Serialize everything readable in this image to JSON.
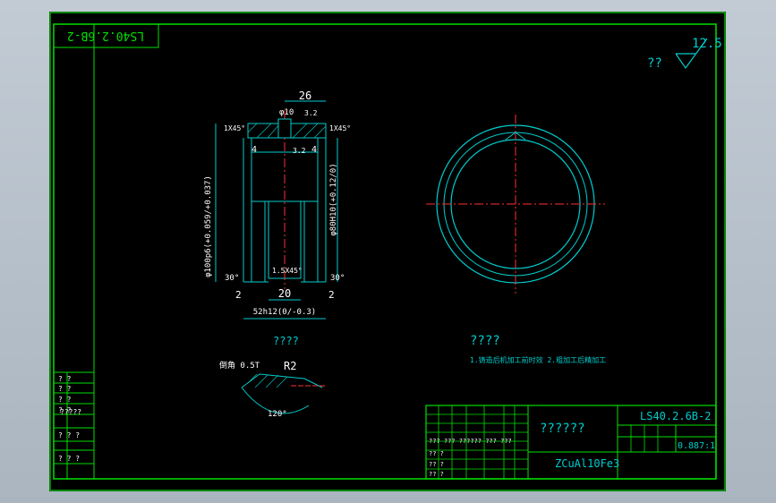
{
  "title_block": {
    "drawing_number": "LS40.2.6B-2",
    "drawing_number_mirrored": "LS40.2.6B-2",
    "part_name": "??????",
    "material": "ZCuAl10Fe3",
    "scale": "0.887:1",
    "row_labels": [
      "?? ??",
      "??",
      "?????",
      "??",
      "??",
      "??"
    ],
    "grid_labels": [
      "??? ??? ?????? ??? ???",
      "?? ?",
      "?? ?",
      "?? ?"
    ]
  },
  "roughness": {
    "value": "12.5",
    "prefix": "??"
  },
  "main_view": {
    "dims": {
      "width_top": "26",
      "hole_dia": "φ10",
      "rough_top": "3.2",
      "chamfer_left": "1X45°",
      "chamfer_right": "1X45°",
      "step_left": "4",
      "step_right": "4",
      "rough_mid": "3.2",
      "outer_dia": "φ100p6(+0.059/+0.037)",
      "inner_dia": "φ80H10(+0.12/0)",
      "angle_left": "30°",
      "angle_right": "30°",
      "bottom_chamfer": "1.5X45°",
      "slot_width": "20",
      "bot_left": "2",
      "bot_right": "2",
      "total_width": "52h12(0/-0.3)"
    }
  },
  "detail_view": {
    "title": "????",
    "radius": "R2",
    "note": "倒角 0.5T",
    "angle": "120°"
  },
  "tech_req": {
    "title": "????",
    "line": "1.铸造后机加工前时效 2.粗加工后精加工"
  },
  "left_sidebar": {
    "rows": [
      "? ?",
      "? ?",
      "? ?",
      "? ?",
      "?????",
      "? ? ?",
      "? ? ?"
    ]
  }
}
